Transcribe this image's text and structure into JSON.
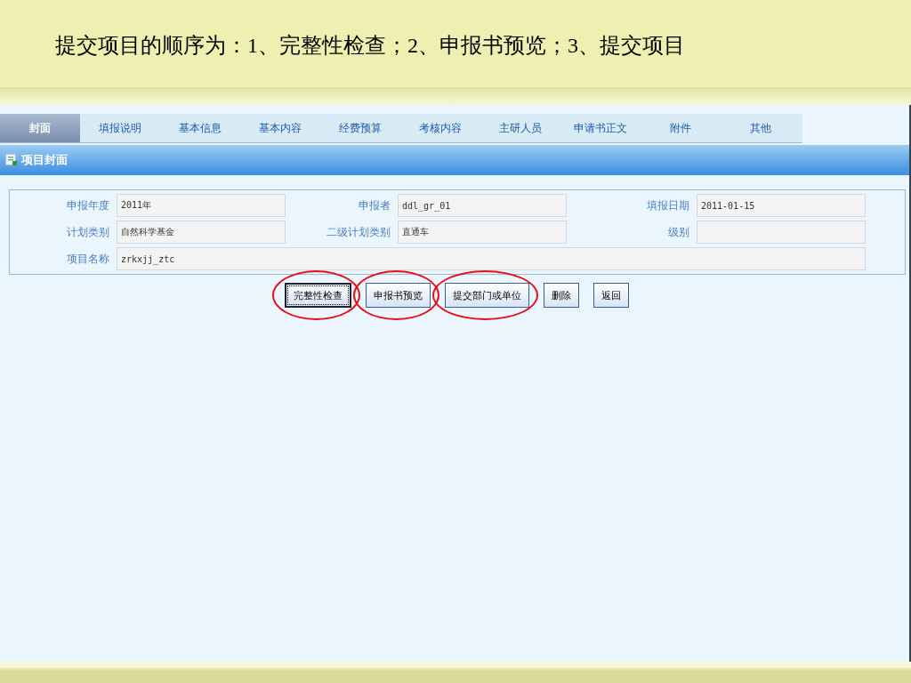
{
  "slide_title": "提交项目的顺序为：1、完整性检查；2、申报书预览；3、提交项目",
  "tabs": [
    {
      "label": "封面",
      "selected": true
    },
    {
      "label": "填报说明",
      "selected": false
    },
    {
      "label": "基本信息",
      "selected": false
    },
    {
      "label": "基本内容",
      "selected": false
    },
    {
      "label": "经费预算",
      "selected": false
    },
    {
      "label": "考核内容",
      "selected": false
    },
    {
      "label": "主研人员",
      "selected": false
    },
    {
      "label": "申请书正文",
      "selected": false
    },
    {
      "label": "附件",
      "selected": false
    },
    {
      "label": "其他",
      "selected": false
    }
  ],
  "section": {
    "title": "项目封面"
  },
  "form": {
    "fields": [
      {
        "kind": "normal",
        "label": "申报年度",
        "value": "2011年"
      },
      {
        "kind": "normal",
        "label": "申报者",
        "value": "ddl_gr_01"
      },
      {
        "kind": "normal",
        "label": "填报日期",
        "value": "2011-01-15"
      },
      {
        "kind": "normal",
        "label": "计划类别",
        "value": "自然科学基金"
      },
      {
        "kind": "normal",
        "label": "二级计划类别",
        "value": "直通车"
      },
      {
        "kind": "normal",
        "label": "级别"
      },
      {
        "kind": "wide",
        "label": "项目名称",
        "value": "zrkxjj_ztc"
      }
    ]
  },
  "buttons": [
    {
      "label": "完整性检查",
      "circled": true,
      "focused": true
    },
    {
      "label": "申报书预览",
      "circled": true,
      "focused": false
    },
    {
      "label": "提交部门或单位",
      "circled": true,
      "focused": false
    },
    {
      "label": "删除",
      "circled": false,
      "focused": false
    },
    {
      "label": "返回",
      "circled": false,
      "focused": false
    }
  ]
}
